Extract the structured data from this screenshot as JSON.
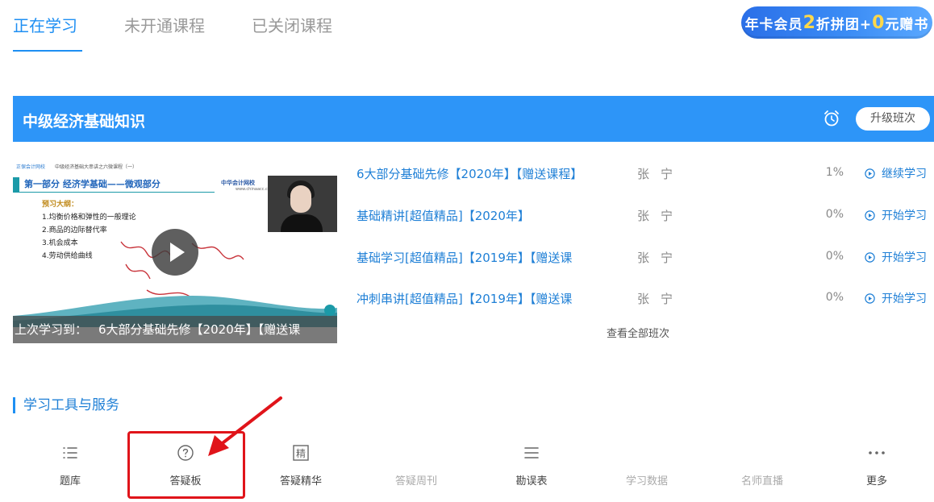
{
  "tabs": [
    {
      "label": "正在学习",
      "active": true
    },
    {
      "label": "未开通课程",
      "active": false
    },
    {
      "label": "已关闭课程",
      "active": false
    }
  ],
  "promo": {
    "part1": "年卡会员",
    "num1": "2",
    "part2": "折拼团+",
    "num2": "0",
    "part3": "元赠书"
  },
  "course": {
    "title": "中级经济基础知识",
    "alarm_icon": "alarm-clock-icon",
    "upgrade_label": "升级班次"
  },
  "video": {
    "slide_logo": "正保会计网校",
    "slide_sub": "中级经济基础大串讲之六微课程（一）",
    "slide_heading": "第一部分    经济学基础——微观部分",
    "slide_brand": "中华会计网校",
    "slide_brand_sub": "www.chinaacc.com",
    "outline_title": "预习大纲：",
    "outline_items": [
      "1.均衡价格和弹性的一般理论",
      "2.商品的边际替代率",
      "3.机会成本",
      "4.劳动供给曲线"
    ],
    "last_study_label": "上次学习到：",
    "last_study_course": "6大部分基础先修【2020年】【赠送课"
  },
  "courses": [
    {
      "name": "6大部分基础先修【2020年】【赠送课程】",
      "teacher": "张宁",
      "progress": "1%",
      "action": "继续学习"
    },
    {
      "name": "基础精讲[超值精品]【2020年】",
      "teacher": "张宁",
      "progress": "0%",
      "action": "开始学习"
    },
    {
      "name": "基础学习[超值精品]【2019年】【赠送课",
      "teacher": "张宁",
      "progress": "0%",
      "action": "开始学习"
    },
    {
      "name": "冲刺串讲[超值精品]【2019年】【赠送课",
      "teacher": "张宁",
      "progress": "0%",
      "action": "开始学习"
    }
  ],
  "view_all": "查看全部班次",
  "services": {
    "title": "学习工具与服务",
    "items": [
      {
        "label": "题库",
        "icon": "list-icon",
        "enabled": true
      },
      {
        "label": "答疑板",
        "icon": "question-circle-icon",
        "enabled": true
      },
      {
        "label": "答疑精华",
        "icon": "essence-icon",
        "enabled": true
      },
      {
        "label": "答疑周刊",
        "icon": "weekly-icon",
        "enabled": false
      },
      {
        "label": "勘误表",
        "icon": "menu-lines-icon",
        "enabled": true
      },
      {
        "label": "学习数据",
        "icon": "data-icon",
        "enabled": false
      },
      {
        "label": "名师直播",
        "icon": "live-icon",
        "enabled": false
      },
      {
        "label": "更多",
        "icon": "more-dots-icon",
        "enabled": true
      }
    ]
  },
  "colors": {
    "accent": "#2d95f8",
    "link": "#1e7fd6",
    "highlight_box": "#e0141a"
  }
}
